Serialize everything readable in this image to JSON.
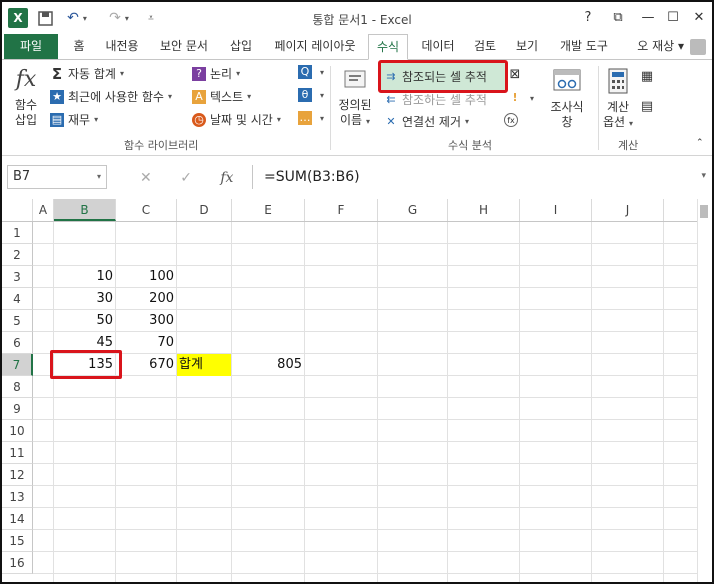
{
  "titlebar": {
    "app_icon_label": "X",
    "title": "통합 문서1 - Excel",
    "help": "?",
    "restore": "⧉",
    "minimize": "—",
    "maximize": "☐",
    "close": "✕"
  },
  "menu": {
    "file": "파일",
    "tabs": [
      "홈",
      "내전용",
      "보안 문서",
      "삽입",
      "페이지 레이아웃",
      "수식",
      "데이터",
      "검토",
      "보기",
      "개발 도구"
    ],
    "active_tab": "수식",
    "user": "오 재상 ▾"
  },
  "ribbon": {
    "insert_function": {
      "icon": "fx",
      "label_1": "함수",
      "label_2": "삽입"
    },
    "autosum": "자동 합계",
    "recent": "최근에 사용한 함수",
    "financial": "재무",
    "logical": "논리",
    "text": "텍스트",
    "datetime": "날짜 및 시간",
    "function_library_label": "함수 라이브러리",
    "defined_names": {
      "label_1": "정의된",
      "label_2": "이름"
    },
    "trace_precedents": "참조되는 셀 추적",
    "trace_dependents": "참조하는 셀 추적",
    "remove_arrows": "연결선 제거",
    "formula_auditing_label": "수식 분석",
    "watch_window": {
      "label_1": "조사식",
      "label_2": "창"
    },
    "calc_options": {
      "label_1": "계산",
      "label_2": "옵션"
    },
    "calculation_label": "계산",
    "accent": "#217346",
    "highlight": "#d9141b"
  },
  "formula_bar": {
    "name_box": "B7",
    "fx": "fx",
    "formula": "=SUM(B3:B6)"
  },
  "grid": {
    "columns": [
      "A",
      "B",
      "C",
      "D",
      "E",
      "F",
      "G",
      "H",
      "I",
      "J"
    ],
    "rows": [
      "1",
      "2",
      "3",
      "4",
      "5",
      "6",
      "7",
      "8",
      "9",
      "10",
      "11",
      "12",
      "13",
      "14",
      "15",
      "16"
    ],
    "selected_column": "B",
    "selected_row": "7",
    "cells": {
      "B3": "10",
      "C3": "100",
      "B4": "30",
      "C4": "200",
      "B5": "50",
      "C5": "300",
      "B6": "45",
      "C6": "70",
      "B7": "135",
      "C7": "670",
      "D7": "합계",
      "E7": "805"
    }
  }
}
